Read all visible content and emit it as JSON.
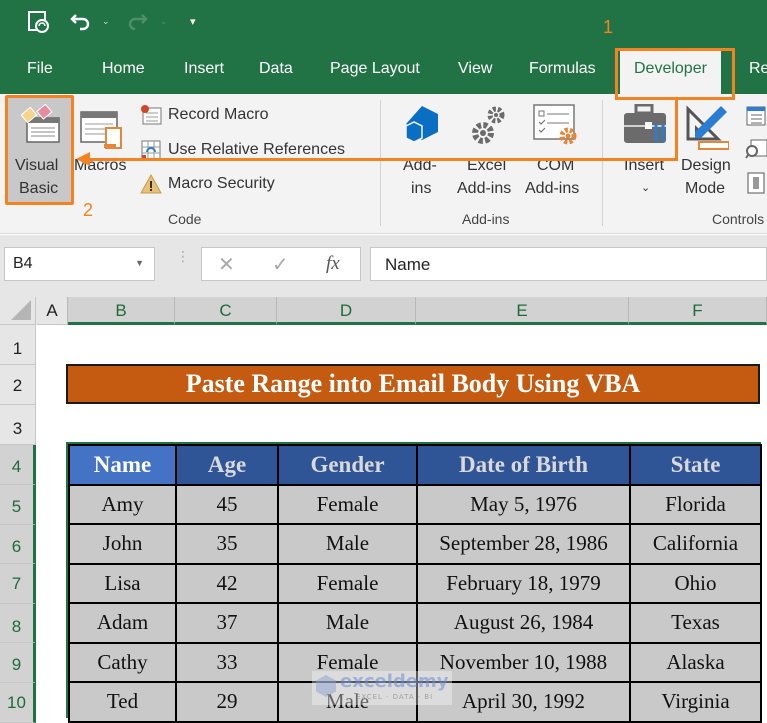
{
  "quick_access": {
    "icons": [
      "autosave-icon",
      "undo-icon",
      "redo-icon",
      "customize-qat-icon"
    ]
  },
  "tabs": [
    {
      "label": "File"
    },
    {
      "label": "Home"
    },
    {
      "label": "Insert"
    },
    {
      "label": "Data"
    },
    {
      "label": "Page Layout"
    },
    {
      "label": "View"
    },
    {
      "label": "Formulas"
    },
    {
      "label": "Developer",
      "active": true
    },
    {
      "label": "Re"
    }
  ],
  "ribbon": {
    "code_group": {
      "visual_basic": "Visual",
      "visual_basic_2": "Basic",
      "macros": "Macros",
      "record_macro": "Record Macro",
      "use_relative": "Use Relative References",
      "macro_security": "Macro Security",
      "label": "Code"
    },
    "addins_group": {
      "addins_1": "Add-",
      "addins_2": "ins",
      "excel_addins_1": "Excel",
      "excel_addins_2": "Add-ins",
      "com_addins_1": "COM",
      "com_addins_2": "Add-ins",
      "label": "Add-ins"
    },
    "controls_group": {
      "insert": "Insert",
      "design_1": "Design",
      "design_2": "Mode",
      "label": "Controls"
    }
  },
  "annotations": {
    "step1": "1",
    "step2": "2",
    "color": "#f58220"
  },
  "formula_bar": {
    "name_box": "B4",
    "cancel": "✕",
    "enter": "✓",
    "fx": "fx",
    "value": "Name"
  },
  "columns": [
    "A",
    "B",
    "C",
    "D",
    "E",
    "F"
  ],
  "rows": [
    "1",
    "2",
    "3",
    "4",
    "5",
    "6",
    "7",
    "8",
    "9",
    "10"
  ],
  "sheet": {
    "title": "Paste Range into Email Body Using VBA",
    "title_color": "#c55a11",
    "headers": [
      "Name",
      "Age",
      "Gender",
      "Date of Birth",
      "State"
    ],
    "data": [
      [
        "Amy",
        "45",
        "Female",
        "May 5, 1976",
        "Florida"
      ],
      [
        "John",
        "35",
        "Male",
        "September 28, 1986",
        "California"
      ],
      [
        "Lisa",
        "42",
        "Female",
        "February 18, 1979",
        "Ohio"
      ],
      [
        "Adam",
        "37",
        "Male",
        "August 26, 1984",
        "Texas"
      ],
      [
        "Cathy",
        "33",
        "Female",
        "November 10, 1988",
        "Alaska"
      ],
      [
        "Ted",
        "29",
        "Male",
        "April 30, 1992",
        "Virginia"
      ]
    ]
  },
  "watermark": {
    "text": "exceldemy",
    "sub": "EXCEL · DATA · BI"
  },
  "colors": {
    "excel_green": "#217346",
    "header_blue": "#2f5597",
    "header_blue_light": "#4472c4",
    "cell_gray": "#c9c9c9"
  }
}
